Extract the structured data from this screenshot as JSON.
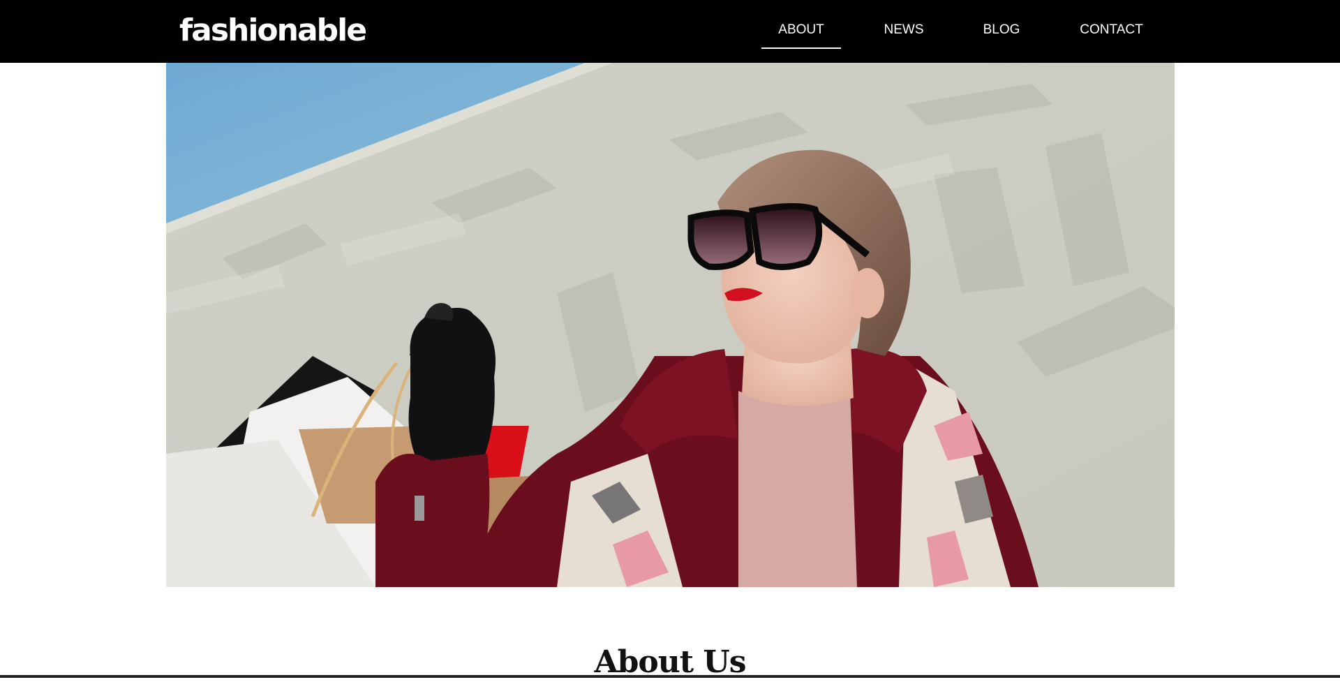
{
  "brand": {
    "logo_text": "fashionable"
  },
  "nav": {
    "items": [
      {
        "label": "ABOUT",
        "active": true
      },
      {
        "label": "NEWS",
        "active": false
      },
      {
        "label": "BLOG",
        "active": false
      },
      {
        "label": "CONTACT",
        "active": false
      }
    ]
  },
  "hero": {
    "image_description": "woman in sunglasses holding shopping bags"
  },
  "about": {
    "title": "About Us"
  },
  "colors": {
    "navbar": "#000000",
    "nav_text": "#ffffff",
    "background": "#ffffff",
    "title_text": "#111111"
  }
}
